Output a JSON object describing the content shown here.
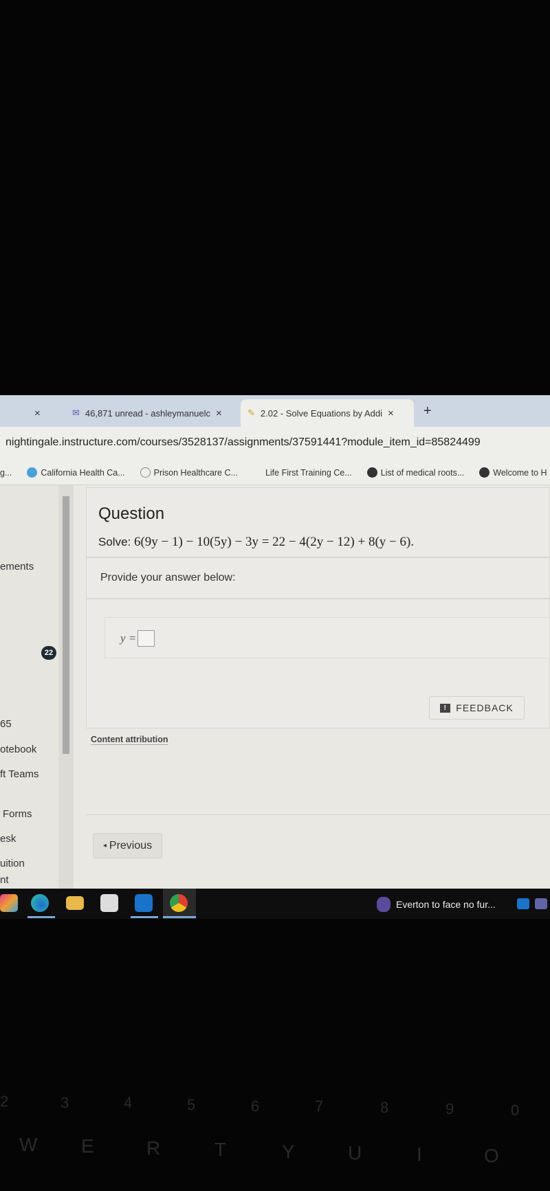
{
  "browser": {
    "tabs": [
      {
        "label": "",
        "close": "×"
      },
      {
        "label": "46,871 unread - ashleymanuelc",
        "icon": "mail-icon",
        "close": "×"
      },
      {
        "label": "2.02 - Solve Equations by Addi",
        "icon": "pencil-icon",
        "close": "×",
        "active": true
      }
    ],
    "new_tab": "+",
    "url": "nightingale.instructure.com/courses/3528137/assignments/37591441?module_item_id=85824499",
    "bookmarks": [
      "g...",
      "California Health Ca...",
      "Prison Healthcare C...",
      "Life First Training Ce...",
      "List of medical roots...",
      "Welcome to H"
    ]
  },
  "sidebar": {
    "items": [
      "ements",
      "65",
      "otebook",
      "ft Teams",
      "Forms",
      "esk",
      "uition",
      "nt"
    ],
    "badge": "22"
  },
  "question": {
    "title": "Question",
    "prefix": "Solve:",
    "equation": "6(9y − 1) − 10(5y) − 3y = 22 − 4(2y − 12) + 8(y − 6).",
    "prompt": "Provide your answer below:",
    "answer_label": "y =",
    "answer_value": ""
  },
  "feedback_label": "FEEDBACK",
  "content_attribution": "Content attribution",
  "previous_label": "Previous",
  "taskbar": {
    "apps": [
      "copilot-icon",
      "edge-icon",
      "file-explorer-icon",
      "store-icon",
      "outlook-icon",
      "chrome-icon"
    ],
    "news": "Everton to face no fur..."
  },
  "keyboard": {
    "numbers": [
      "2",
      "3",
      "4",
      "5",
      "6",
      "7",
      "8",
      "9",
      "0"
    ],
    "letters": [
      "W",
      "E",
      "R",
      "T",
      "Y",
      "U",
      "I",
      "O"
    ]
  },
  "colors": {
    "tabbar": "#cdd6e3",
    "taskbar": "#0e0e0f",
    "page": "#e9e8e3"
  }
}
